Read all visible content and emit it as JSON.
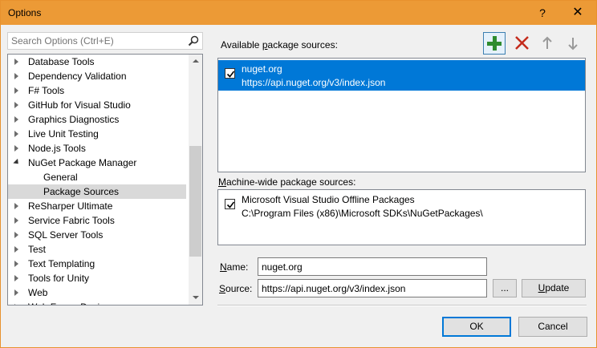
{
  "window": {
    "title": "Options",
    "help_label": "?",
    "close_label": "✕"
  },
  "search": {
    "placeholder": "Search Options (Ctrl+E)"
  },
  "tree": {
    "items": [
      {
        "label": "Database Tools",
        "state": "collapsed"
      },
      {
        "label": "Dependency Validation",
        "state": "collapsed"
      },
      {
        "label": "F# Tools",
        "state": "collapsed"
      },
      {
        "label": "GitHub for Visual Studio",
        "state": "collapsed"
      },
      {
        "label": "Graphics Diagnostics",
        "state": "collapsed"
      },
      {
        "label": "Live Unit Testing",
        "state": "collapsed"
      },
      {
        "label": "Node.js Tools",
        "state": "collapsed"
      },
      {
        "label": "NuGet Package Manager",
        "state": "expanded"
      },
      {
        "label": "General",
        "state": "child"
      },
      {
        "label": "Package Sources",
        "state": "child-selected"
      },
      {
        "label": "ReSharper Ultimate",
        "state": "collapsed"
      },
      {
        "label": "Service Fabric Tools",
        "state": "collapsed"
      },
      {
        "label": "SQL Server Tools",
        "state": "collapsed"
      },
      {
        "label": "Test",
        "state": "collapsed"
      },
      {
        "label": "Text Templating",
        "state": "collapsed"
      },
      {
        "label": "Tools for Unity",
        "state": "collapsed"
      },
      {
        "label": "Web",
        "state": "collapsed"
      },
      {
        "label": "Web Forms Designer",
        "state": "collapsed"
      }
    ]
  },
  "available": {
    "label_prefix": "Available ",
    "label_accel": "p",
    "label_suffix": "ackage sources:",
    "sources": [
      {
        "name": "nuget.org",
        "url": "https://api.nuget.org/v3/index.json",
        "checked": true,
        "selected": true
      }
    ]
  },
  "machine": {
    "label_accel": "M",
    "label_suffix": "achine-wide package sources:",
    "sources": [
      {
        "name": "Microsoft Visual Studio Offline Packages",
        "url": "C:\\Program Files (x86)\\Microsoft SDKs\\NuGetPackages\\",
        "checked": true
      }
    ]
  },
  "form": {
    "name_accel": "N",
    "name_suffix": "ame:",
    "name_value": "nuget.org",
    "source_accel": "S",
    "source_suffix": "ource:",
    "source_value": "https://api.nuget.org/v3/index.json",
    "browse_label": "...",
    "update_label": "Update",
    "update_accel": "U",
    "update_suffix": "pdate"
  },
  "dialog": {
    "ok_label": "OK",
    "cancel_label": "Cancel"
  },
  "colors": {
    "titlebar": "#ec9a36",
    "selection": "#0078d7",
    "add_green": "#2e8b2e",
    "remove_red": "#c42b1c"
  }
}
